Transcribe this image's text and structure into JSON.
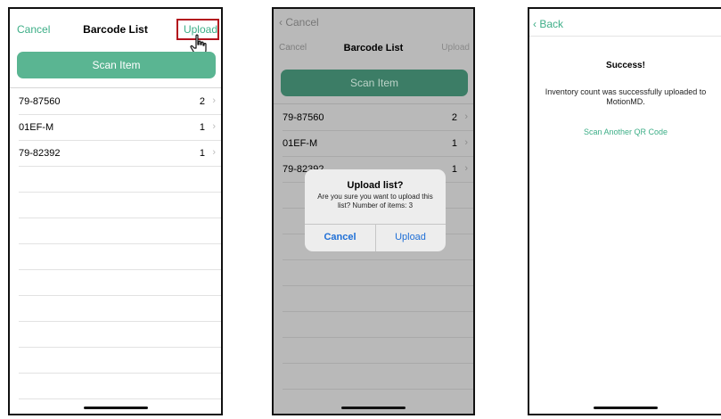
{
  "screen1": {
    "nav": {
      "cancel": "Cancel",
      "title": "Barcode List",
      "upload": "Upload"
    },
    "scan_button": "Scan Item",
    "items": [
      {
        "code": "79-87560",
        "count": "2"
      },
      {
        "code": "01EF-M",
        "count": "1"
      },
      {
        "code": "79-82392",
        "count": "1"
      }
    ]
  },
  "screen2": {
    "back": "Cancel",
    "nav": {
      "cancel": "Cancel",
      "title": "Barcode List",
      "upload": "Upload"
    },
    "scan_button": "Scan Item",
    "items": [
      {
        "code": "79-87560",
        "count": "2"
      },
      {
        "code": "01EF-M",
        "count": "1"
      },
      {
        "code": "79-82392",
        "count": "1"
      }
    ],
    "alert": {
      "title": "Upload list?",
      "message": "Are you sure you want to upload this list? Number of items: 3",
      "cancel": "Cancel",
      "upload": "Upload"
    }
  },
  "screen3": {
    "back": "Back",
    "title": "Success!",
    "message": "Inventory count was successfully uploaded to MotionMD.",
    "scan_again": "Scan Another QR Code"
  },
  "icons": {
    "chevron": "chevron-right-icon",
    "back": "chevron-left-icon",
    "cursor": "hand-pointer-icon"
  },
  "colors": {
    "accent": "#3dae87",
    "scan_button": "#5ab592",
    "highlight": "#b3141d",
    "alert_button": "#1f6fd6"
  }
}
